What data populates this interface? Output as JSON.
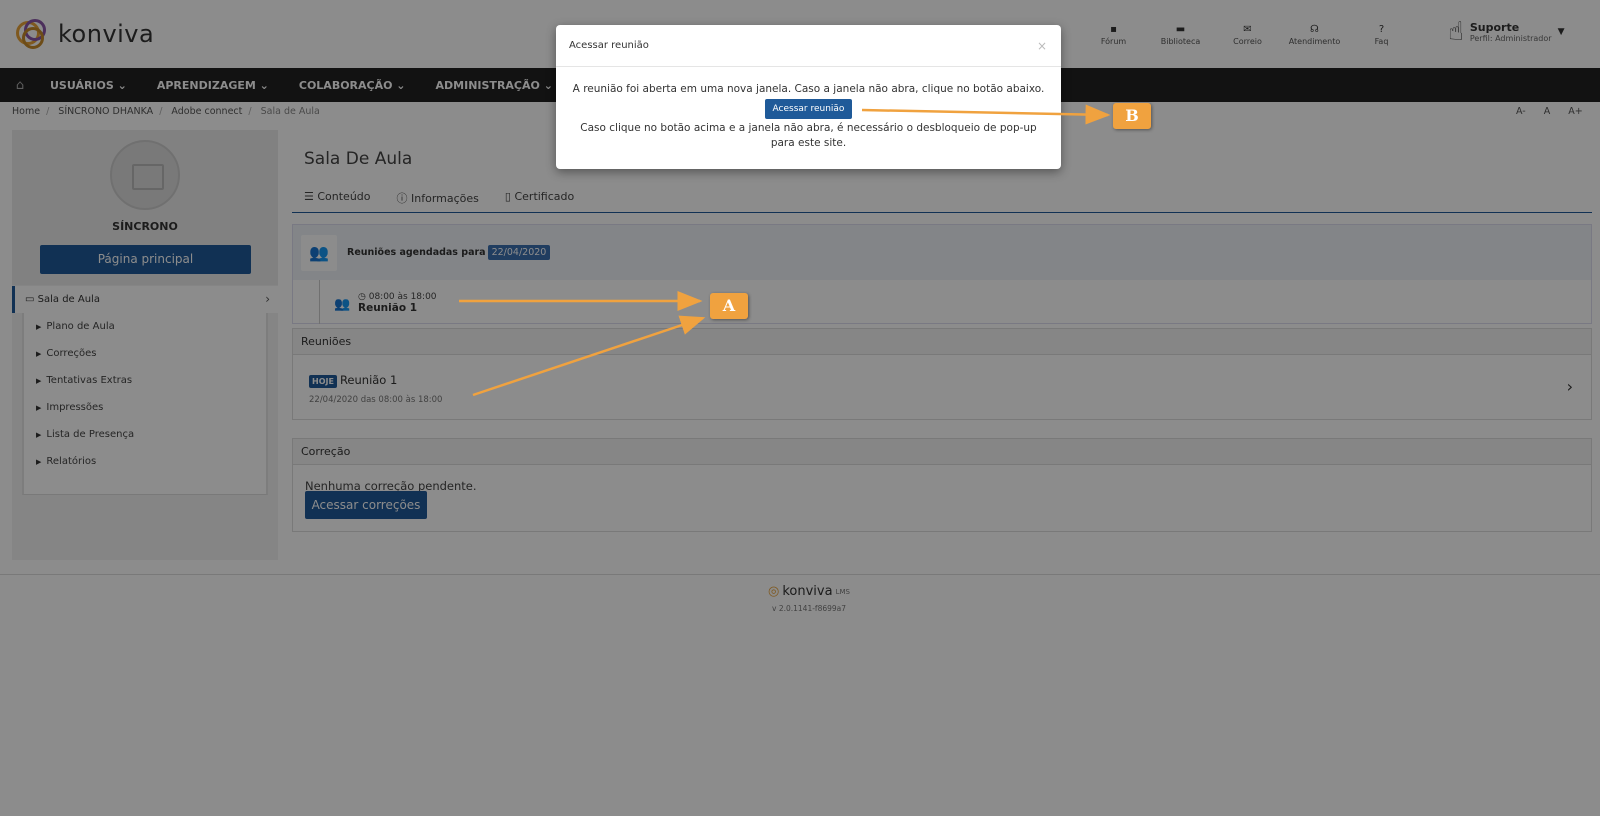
{
  "header": {
    "logo_text": "konviva",
    "nav": [
      {
        "label": "Fórum",
        "icon": "chat-icon",
        "glyph": "▪"
      },
      {
        "label": "Biblioteca",
        "icon": "folder-icon",
        "glyph": "▬"
      },
      {
        "label": "Correio",
        "icon": "envelope-icon",
        "glyph": "✉"
      },
      {
        "label": "Atendimento",
        "icon": "headset-icon",
        "glyph": "☊"
      },
      {
        "label": "Faq",
        "icon": "question-icon",
        "glyph": "?"
      }
    ],
    "user": {
      "name": "Suporte",
      "role": "Perfil: Administrador"
    }
  },
  "navbar": {
    "home_icon": "⌂",
    "menus": [
      "USUÁRIOS ⌄",
      "APRENDIZAGEM ⌄",
      "COLABORAÇÃO ⌄",
      "ADMINISTRAÇÃO ⌄"
    ]
  },
  "breadcrumb": [
    "Home",
    "SÍNCRONO DHANKA",
    "Adobe connect",
    "Sala de Aula"
  ],
  "font_controls": [
    "A-",
    "A",
    "A+"
  ],
  "sidebar": {
    "name": "SÍNCRONO",
    "main_button": "Página principal",
    "active_item": "Sala de Aula",
    "items": [
      "Plano de Aula",
      "Correções",
      "Tentativas Extras",
      "Impressões",
      "Lista de Presença",
      "Relatórios"
    ]
  },
  "main": {
    "title": "Sala De Aula",
    "tabs": [
      "Conteúdo",
      "Informações",
      "Certificado"
    ],
    "schedule": {
      "label": "Reuniões agendadas para",
      "date": "22/04/2020",
      "time": "08:00 às 18:00",
      "meeting": "Reunião 1"
    },
    "meetings_panel": {
      "title": "Reuniões",
      "badge": "HOJE",
      "meeting": "Reunião 1",
      "date": "22/04/2020 das 08:00 às 18:00"
    },
    "correction_panel": {
      "title": "Correção",
      "text": "Nenhuma correção pendente.",
      "button": "Acessar correções"
    }
  },
  "footer": {
    "logo": "konviva",
    "suffix": "LMS",
    "version": "v 2.0.1141-f8699a7"
  },
  "modal": {
    "title": "Acessar reunião",
    "line1": "A reunião foi aberta em uma nova janela. Caso a janela não abra, clique no botão abaixo.",
    "button": "Acessar reunião",
    "line2": "Caso clique no botão acima e a janela não abra, é necessário o desbloqueio de pop-up para este site.",
    "close": "×"
  },
  "annotations": {
    "a": "A",
    "b": "B",
    "color": "#f0a23f"
  }
}
